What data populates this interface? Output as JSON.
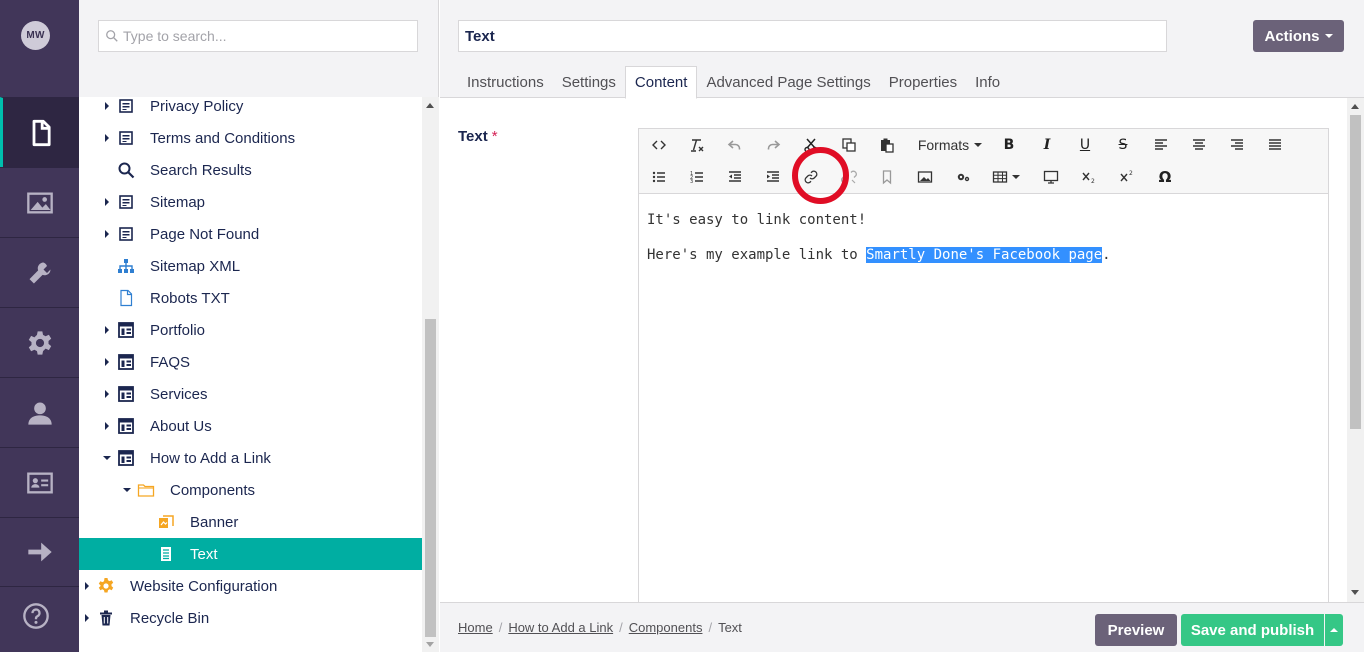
{
  "user": {
    "initials": "MW"
  },
  "app_nav": {
    "items": [
      {
        "name": "content",
        "icon": "document-icon",
        "active": true
      },
      {
        "name": "media",
        "icon": "image-icon",
        "active": false
      },
      {
        "name": "settings",
        "icon": "wrench-icon",
        "active": false
      },
      {
        "name": "developer",
        "icon": "gear-icon",
        "active": false
      },
      {
        "name": "users",
        "icon": "user-icon",
        "active": false
      },
      {
        "name": "members",
        "icon": "id-card-icon",
        "active": false
      },
      {
        "name": "forms",
        "icon": "arrow-right-icon",
        "active": false
      }
    ],
    "help_icon": "question-circle-icon"
  },
  "tree": {
    "search_placeholder": "Type to search...",
    "nodes": [
      {
        "label": "Privacy Policy",
        "icon": "page-icon",
        "level": 1,
        "caret": "right"
      },
      {
        "label": "Terms and Conditions",
        "icon": "page-icon",
        "level": 1,
        "caret": "right"
      },
      {
        "label": "Search Results",
        "icon": "search-icon",
        "level": 1,
        "caret": "none"
      },
      {
        "label": "Sitemap",
        "icon": "page-icon",
        "level": 1,
        "caret": "right"
      },
      {
        "label": "Page Not Found",
        "icon": "page-icon",
        "level": 1,
        "caret": "right"
      },
      {
        "label": "Sitemap XML",
        "icon": "sitemap-icon",
        "level": 1,
        "caret": "none"
      },
      {
        "label": "Robots TXT",
        "icon": "file-icon",
        "level": 1,
        "caret": "none"
      },
      {
        "label": "Portfolio",
        "icon": "layout-icon",
        "level": 1,
        "caret": "right"
      },
      {
        "label": "FAQS",
        "icon": "layout-icon",
        "level": 1,
        "caret": "right"
      },
      {
        "label": "Services",
        "icon": "layout-icon",
        "level": 1,
        "caret": "right"
      },
      {
        "label": "About Us",
        "icon": "layout-icon",
        "level": 1,
        "caret": "right"
      },
      {
        "label": "How to Add a Link",
        "icon": "layout-icon",
        "level": 1,
        "caret": "down"
      },
      {
        "label": "Components",
        "icon": "folder-icon",
        "level": 2,
        "caret": "down"
      },
      {
        "label": "Banner",
        "icon": "banner-icon",
        "level": 3,
        "caret": "none"
      },
      {
        "label": "Text",
        "icon": "text-doc-icon",
        "level": 3,
        "caret": "none",
        "selected": true
      },
      {
        "label": "Website Configuration",
        "icon": "settings-gear-icon",
        "level": 0,
        "caret": "right"
      },
      {
        "label": "Recycle Bin",
        "icon": "trash-icon",
        "level": 0,
        "caret": "right"
      }
    ]
  },
  "editor": {
    "node_name": "Text",
    "actions_label": "Actions",
    "tabs": [
      "Instructions",
      "Settings",
      "Content",
      "Advanced Page Settings",
      "Properties",
      "Info"
    ],
    "active_tab": "Content",
    "field_label": "Text",
    "required_mark": "*",
    "formats_label": "Formats",
    "toolbar_row1": [
      "source-code-icon",
      "clear-format-icon",
      "undo-icon",
      "redo-icon",
      "cut-icon",
      "copy-icon",
      "paste-icon",
      "formats-dropdown",
      "bold-icon",
      "italic-icon",
      "underline-icon",
      "strikethrough-icon",
      "align-left-icon",
      "align-center-icon",
      "align-right-icon",
      "justify-icon"
    ],
    "toolbar_row2": [
      "bullet-list-icon",
      "numbered-list-icon",
      "outdent-icon",
      "indent-icon",
      "link-icon",
      "unlink-icon",
      "anchor-icon",
      "insert-image-icon",
      "macro-icon",
      "table-icon",
      "embed-icon",
      "subscript-icon",
      "superscript-icon",
      "special-char-icon"
    ],
    "content": {
      "para1": "It's easy to link content!",
      "para2_prefix": "Here's my example link to ",
      "para2_selected": "Smartly Done's Facebook page",
      "para2_suffix": "."
    },
    "highlight_color": "#e00d25",
    "selection_color": "#3390ff"
  },
  "footer": {
    "breadcrumb": [
      {
        "label": "Home",
        "link": true
      },
      {
        "label": "How to Add a Link",
        "link": true
      },
      {
        "label": "Components",
        "link": true
      },
      {
        "label": "Text",
        "link": false
      }
    ],
    "preview_label": "Preview",
    "publish_label": "Save and publish"
  },
  "colors": {
    "nav_bg": "#413659",
    "accent_teal": "#00aea2",
    "publish_green": "#35c786",
    "button_purple": "#6b6279"
  }
}
